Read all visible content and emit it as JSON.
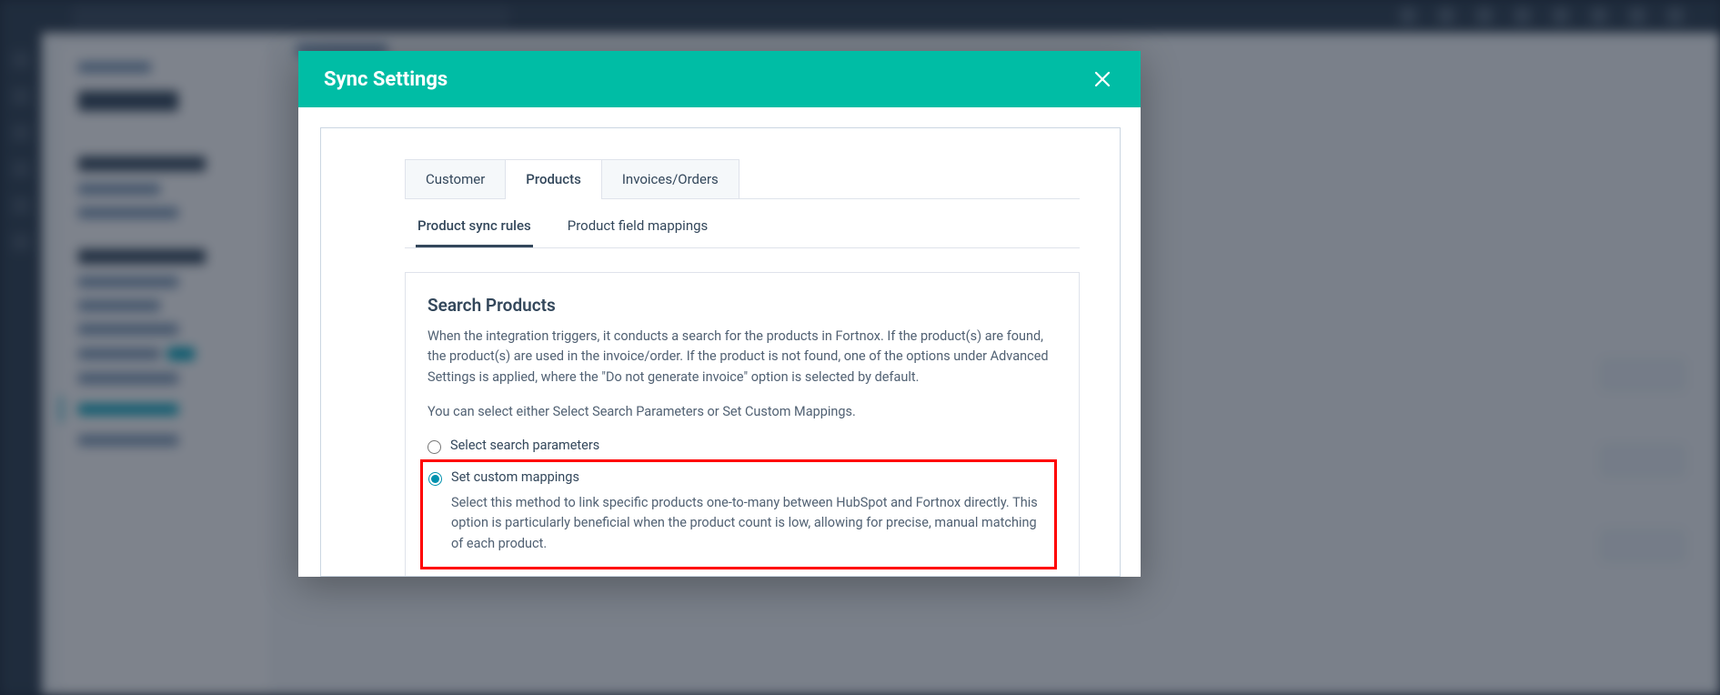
{
  "modal": {
    "title": "Sync Settings",
    "tabs": [
      {
        "label": "Customer"
      },
      {
        "label": "Products"
      },
      {
        "label": "Invoices/Orders"
      }
    ],
    "subtabs": [
      {
        "label": "Product sync rules"
      },
      {
        "label": "Product field mappings"
      }
    ],
    "panel": {
      "title": "Search Products",
      "para1": "When the integration triggers, it conducts a search for the products in Fortnox. If the product(s) are found, the product(s) are used in the invoice/order. If the product is not found, one of the options under Advanced Settings is applied, where the \"Do not generate invoice\" option is selected by default.",
      "para2": "You can select either Select Search Parameters or Set Custom Mappings.",
      "option1_label": "Select search parameters",
      "option2_label": "Set custom mappings",
      "option2_desc": "Select this method to link specific products one-to-many between HubSpot and Fortnox directly. This option is particularly beneficial when the product count is low, allowing for precise, manual matching of each product."
    }
  }
}
